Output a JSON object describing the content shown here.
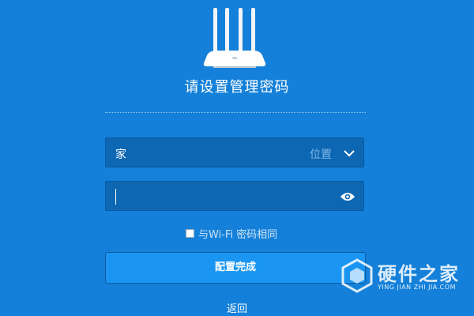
{
  "page": {
    "title": "请设置管理密码"
  },
  "location_field": {
    "value": "家",
    "label": "位置"
  },
  "password_field": {
    "value": ""
  },
  "same_as_wifi": {
    "label": "与Wi-Fi 密码相同",
    "checked": false
  },
  "submit_button": {
    "label": "配置完成"
  },
  "back_link": {
    "label": "返回"
  },
  "watermark": {
    "title": "硬件之家",
    "subtitle": "YING JIAN ZHI JIA.COM"
  },
  "colors": {
    "background": "#1480d9",
    "field": "#0d67b3",
    "button": "#1a96f2"
  }
}
